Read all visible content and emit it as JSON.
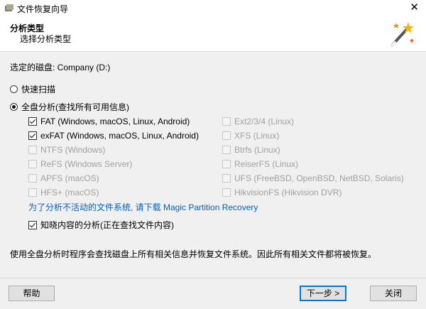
{
  "window": {
    "title": "文件恢复向导",
    "close_label": "✕"
  },
  "header": {
    "step_title": "分析类型",
    "step_subtitle": "选择分析类型"
  },
  "main": {
    "selected_disk": "选定的磁盘: Company (D:)",
    "quick_scan": {
      "label": "快速扫描",
      "selected": false
    },
    "full_analysis": {
      "label": "全盘分析(查找所有可用信息)",
      "selected": true
    },
    "fs_left": [
      {
        "label": "FAT (Windows, macOS, Linux, Android)",
        "checked": true,
        "enabled": true
      },
      {
        "label": "exFAT (Windows, macOS, Linux, Android)",
        "checked": true,
        "enabled": true
      },
      {
        "label": "NTFS (Windows)",
        "checked": false,
        "enabled": false
      },
      {
        "label": "ReFS (Windows Server)",
        "checked": false,
        "enabled": false
      },
      {
        "label": "APFS (macOS)",
        "checked": false,
        "enabled": false
      },
      {
        "label": "HFS+ (macOS)",
        "checked": false,
        "enabled": false
      }
    ],
    "fs_right": [
      {
        "label": "Ext2/3/4 (Linux)",
        "checked": false,
        "enabled": false
      },
      {
        "label": "XFS (Linux)",
        "checked": false,
        "enabled": false
      },
      {
        "label": "Btrfs (Linux)",
        "checked": false,
        "enabled": false
      },
      {
        "label": "ReiserFS (Linux)",
        "checked": false,
        "enabled": false
      },
      {
        "label": "UFS (FreeBSD, OpenBSD, NetBSD, Solaris)",
        "checked": false,
        "enabled": false
      },
      {
        "label": "HikvisionFS (Hikvision DVR)",
        "checked": false,
        "enabled": false
      }
    ],
    "download_link": "为了分析不活动的文件系统, 请下载 Magic Partition Recovery",
    "content_aware": {
      "label": "知晓内容的分析(正在查找文件内容)",
      "checked": true
    },
    "note": "使用全盘分析时程序会查找磁盘上所有相关信息并恢复文件系统。因此所有相关文件都将被恢复。"
  },
  "footer": {
    "help_label": "帮助",
    "next_label": "下一步 >",
    "close_label": "关闭"
  }
}
